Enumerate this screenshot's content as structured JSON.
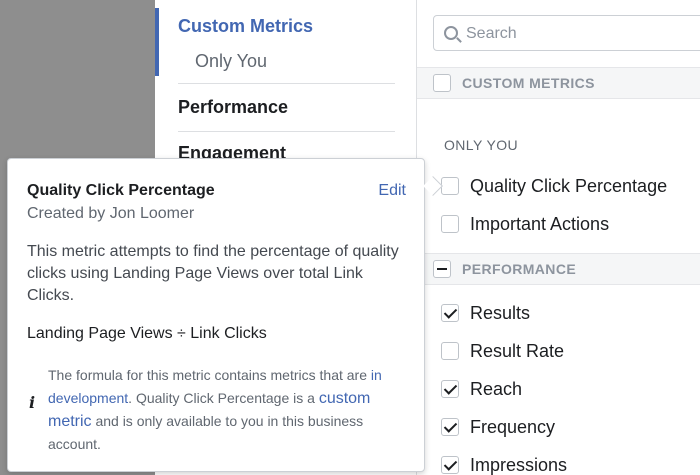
{
  "nav": {
    "items": [
      {
        "label": "Custom Metrics",
        "color": "#4267b2"
      },
      {
        "label": "Only You",
        "sub": true
      },
      {
        "label": "Performance"
      },
      {
        "label": "Engagement"
      }
    ]
  },
  "search": {
    "placeholder": "Search"
  },
  "sections": {
    "custom_metrics": "CUSTOM METRICS",
    "only_you": "ONLY YOU",
    "performance": "PERFORMANCE"
  },
  "custom_items": [
    {
      "label": "Quality Click Percentage",
      "checked": false
    },
    {
      "label": "Important Actions",
      "checked": false
    }
  ],
  "performance_items": [
    {
      "label": "Results",
      "checked": true
    },
    {
      "label": "Result Rate",
      "checked": false
    },
    {
      "label": "Reach",
      "checked": true
    },
    {
      "label": "Frequency",
      "checked": true
    },
    {
      "label": "Impressions",
      "checked": true
    }
  ],
  "tooltip": {
    "title": "Quality Click Percentage",
    "edit": "Edit",
    "created_by": "Created by Jon Loomer",
    "description": "This metric attempts to find the percentage of quality clicks using Landing Page Views over total Link Clicks.",
    "formula": "Landing Page Views ÷ Link Clicks",
    "note_icon": "i",
    "note_part1": "The formula for this metric contains metrics that are ",
    "note_link1": "in development",
    "note_part2": ". Quality Click Percentage is a ",
    "note_link2": "custom metric",
    "note_part3": " and is only available to you in this business account."
  },
  "colors": {
    "accent": "#4267b2",
    "muted": "#8d949e"
  }
}
